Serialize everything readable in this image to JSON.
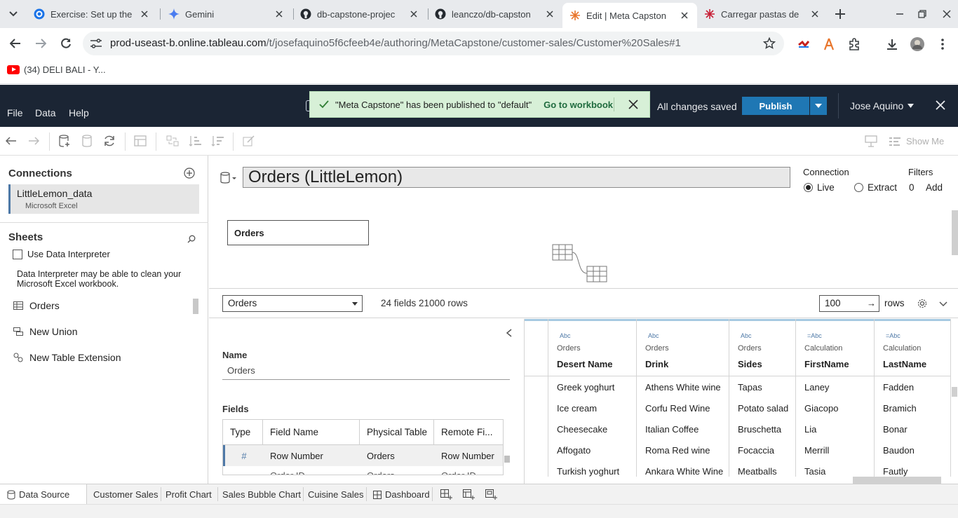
{
  "browser": {
    "tabs": [
      {
        "label": "Exercise: Set up the",
        "icon": "coursera-icon"
      },
      {
        "label": "Gemini",
        "icon": "gemini-icon"
      },
      {
        "label": "db-capstone-projec",
        "icon": "github-icon"
      },
      {
        "label": "leanczo/db-capston",
        "icon": "github-icon"
      },
      {
        "label": "Edit | Meta Capston",
        "icon": "tableau-icon"
      },
      {
        "label": "Carregar pastas de",
        "icon": "tableau-icon"
      }
    ],
    "url_host": "prod-useast-b.online.tableau.com",
    "url_path": "/t/josefaquino5f6cfeeb4e/authoring/MetaCapstone/customer-sales/Customer%20Sales#1",
    "bookmark": "(34) DELI BALI - Y..."
  },
  "tableau": {
    "menu": {
      "file": "File",
      "data": "Data",
      "help": "Help"
    },
    "toast": {
      "message": "\"Meta Capstone\" has been published to \"default\"",
      "link": "Go to workbook"
    },
    "saved_status": "All changes saved",
    "publish_label": "Publish",
    "user_name": "Jose Aquino",
    "show_me": "Show Me"
  },
  "left_panel": {
    "connections_title": "Connections",
    "connection": {
      "name": "LittleLemon_data",
      "type": "Microsoft Excel"
    },
    "sheets_title": "Sheets",
    "use_interpreter": "Use Data Interpreter",
    "interpreter_text": "Data Interpreter may be able to clean your Microsoft Excel workbook.",
    "sheets": [
      {
        "label": "Orders",
        "icon": "table-icon"
      },
      {
        "label": "New Union",
        "icon": "union-icon"
      },
      {
        "label": "New Table Extension",
        "icon": "extension-icon"
      }
    ]
  },
  "canvas": {
    "datasource_title": "Orders (LittleLemon)",
    "connection_label": "Connection",
    "live_label": "Live",
    "extract_label": "Extract",
    "connection_mode": "Live",
    "filters_label": "Filters",
    "filters_count": "0",
    "filters_add": "Add",
    "table_name": "Orders"
  },
  "lower_bar": {
    "table_select": "Orders",
    "fields_rows": "24 fields 21000 rows",
    "rows_value": "100",
    "rows_label": "rows"
  },
  "metadata": {
    "name_label": "Name",
    "name_value": "Orders",
    "fields_label": "Fields",
    "columns": [
      "Type",
      "Field Name",
      "Physical Table",
      "Remote Fi..."
    ],
    "rows": [
      {
        "type": "#",
        "field": "Row Number",
        "table": "Orders",
        "remote": "Row Number"
      },
      {
        "type": "",
        "field": "Order ID",
        "table": "Orders",
        "remote": "Order ID"
      }
    ]
  },
  "grid": {
    "columns": [
      {
        "type": "Abc",
        "source": "Orders",
        "name": "Desert Name"
      },
      {
        "type": "Abc",
        "source": "Orders",
        "name": "Drink"
      },
      {
        "type": "Abc",
        "source": "Orders",
        "name": "Sides"
      },
      {
        "type": "=Abc",
        "source": "Calculation",
        "name": "FirstName"
      },
      {
        "type": "=Abc",
        "source": "Calculation",
        "name": "LastName"
      }
    ],
    "rows": [
      [
        "Greek yoghurt",
        "Athens White wine",
        "Tapas",
        "Laney",
        "Fadden"
      ],
      [
        "Ice cream",
        "Corfu Red Wine",
        "Potato salad",
        "Giacopo",
        "Bramich"
      ],
      [
        "Cheesecake",
        "Italian Coffee",
        "Bruschetta",
        "Lia",
        "Bonar"
      ],
      [
        "Affogato",
        "Roma Red wine",
        "Focaccia",
        "Merrill",
        "Baudon"
      ],
      [
        "Turkish yoghurt",
        "Ankara White Wine",
        "Meatballs",
        "Tasia",
        "Fautly"
      ]
    ]
  },
  "bottom_tabs": {
    "data_source": "Data Source",
    "sheets": [
      "Customer Sales",
      "Profit Chart",
      "Sales Bubble Chart",
      "Cuisine Sales"
    ],
    "dashboard": "Dashboard"
  },
  "colors": {
    "tableau_header": "#1b2534",
    "publish_blue": "#1f77b4",
    "toast_green": "#d7f0d7",
    "accent": "#4e79a7"
  }
}
